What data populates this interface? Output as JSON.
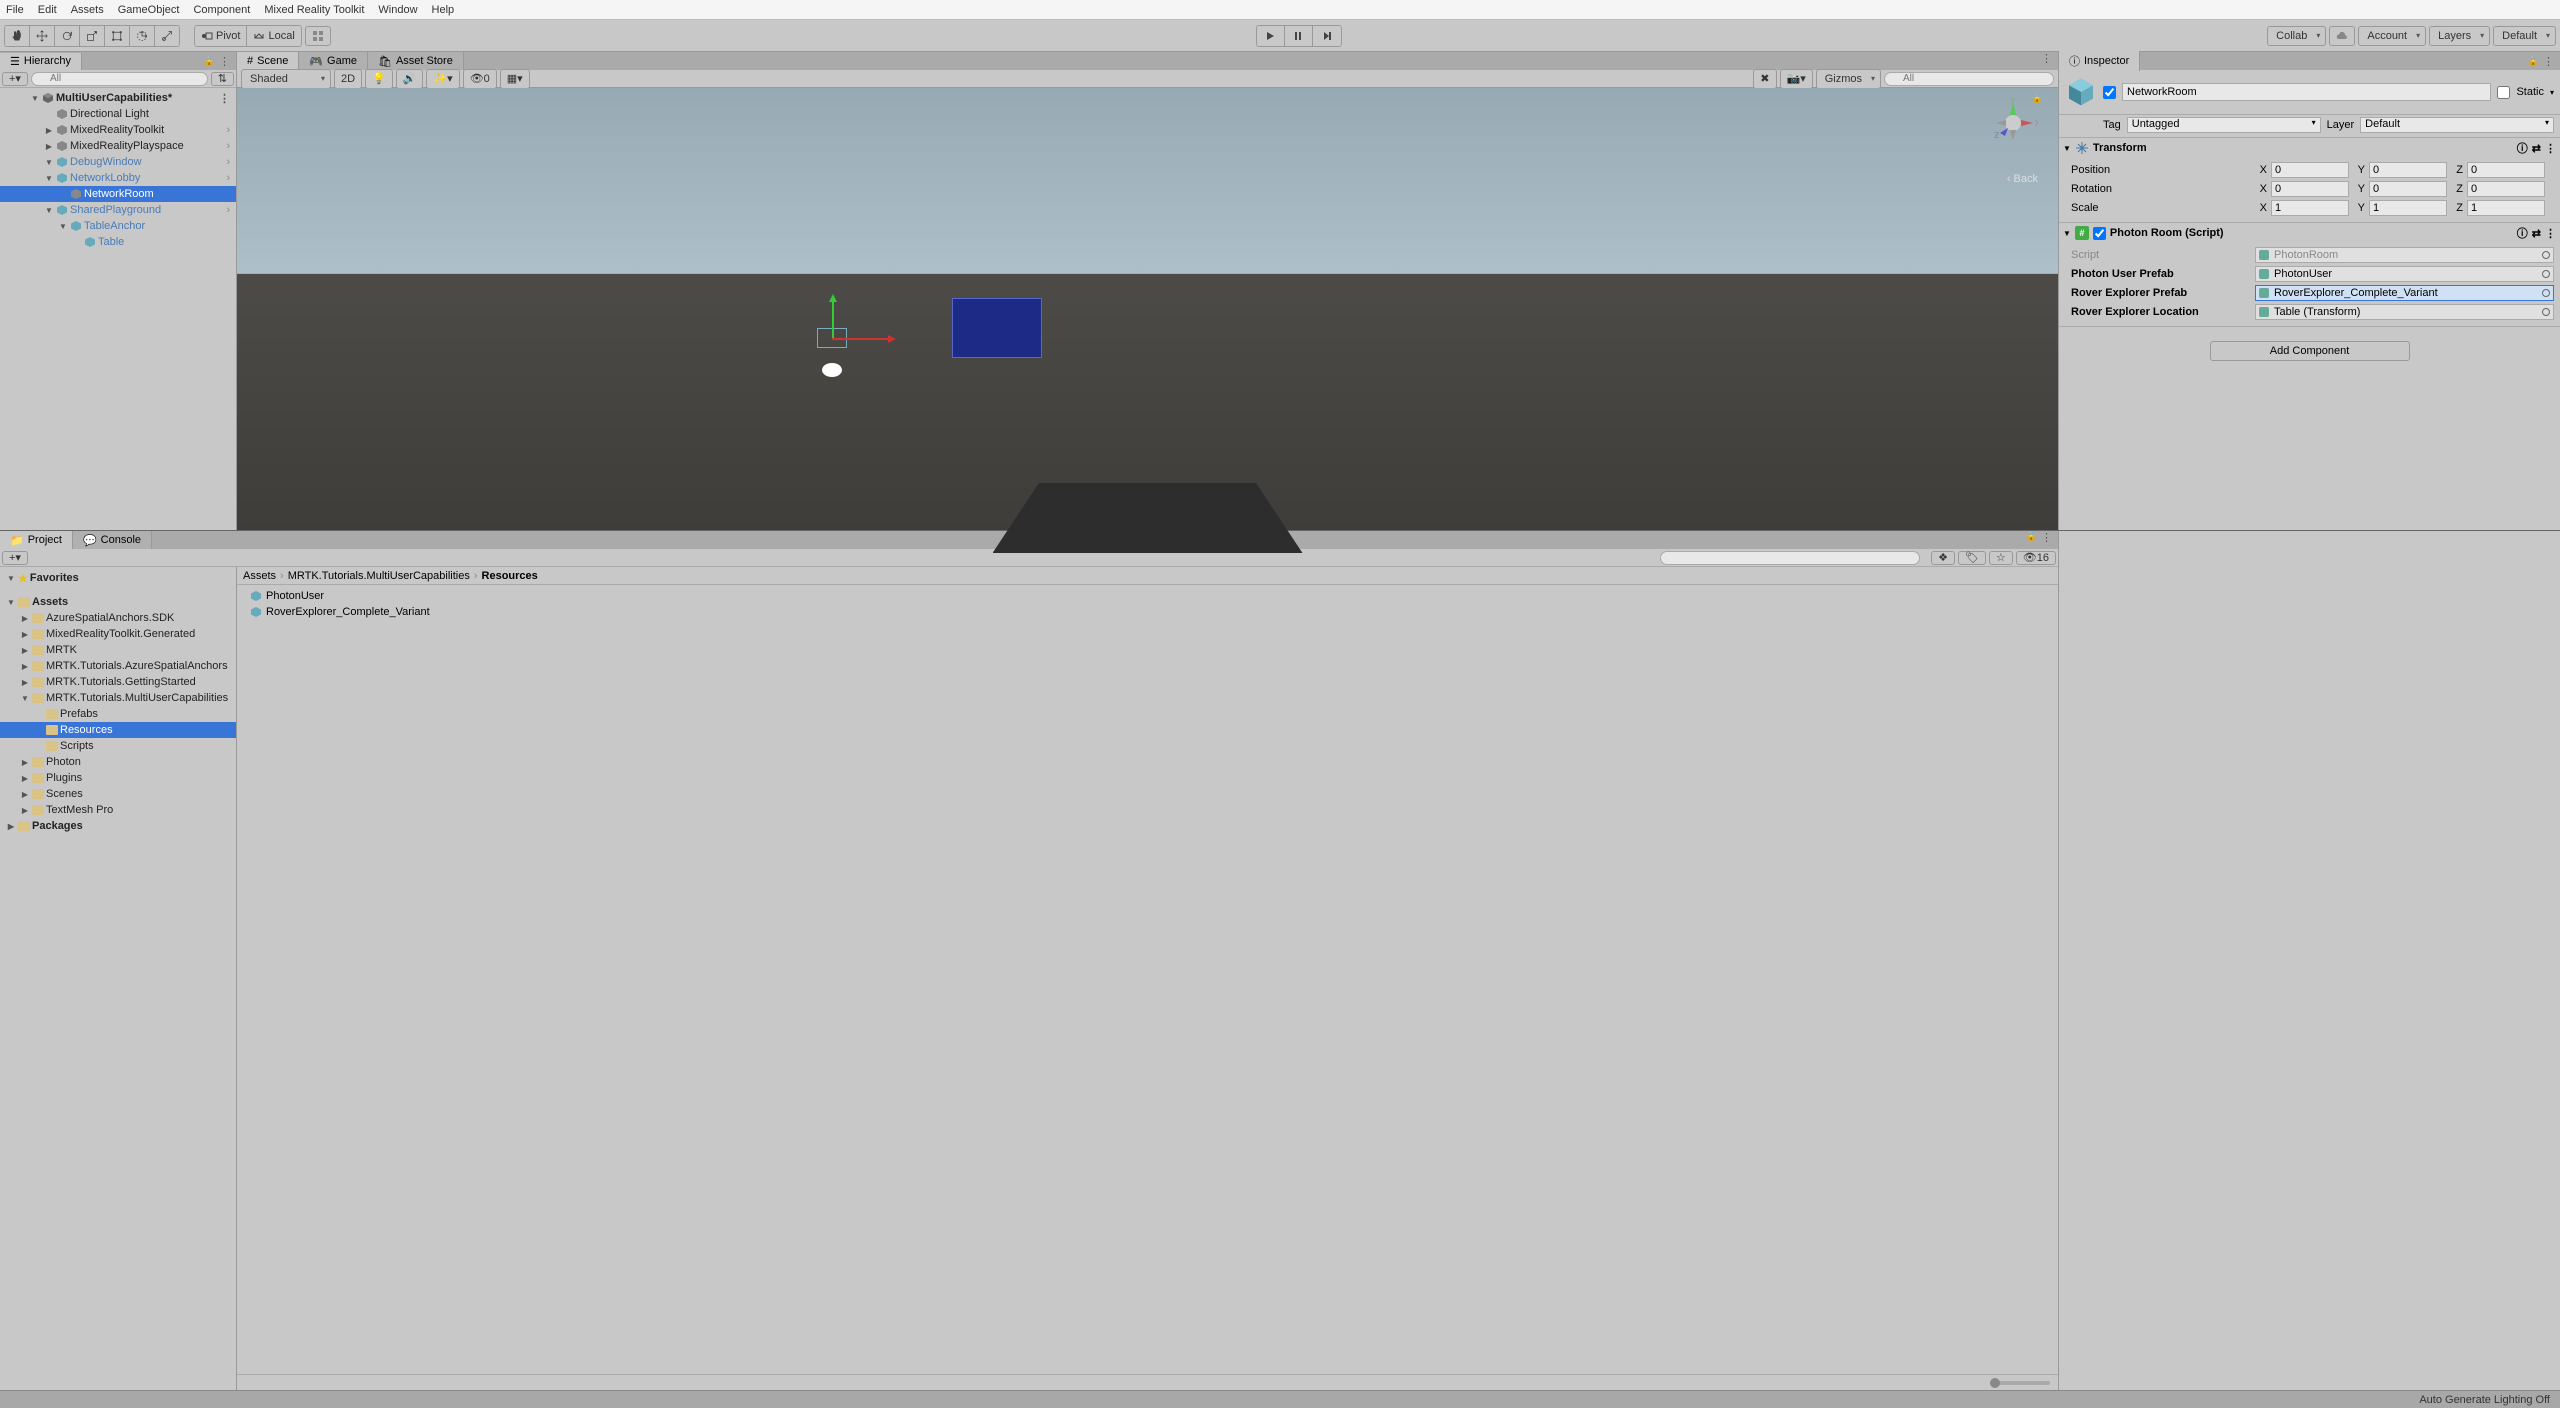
{
  "menubar": [
    "File",
    "Edit",
    "Assets",
    "GameObject",
    "Component",
    "Mixed Reality Toolkit",
    "Window",
    "Help"
  ],
  "toolbar": {
    "pivot": "Pivot",
    "local": "Local",
    "collab": "Collab",
    "account": "Account",
    "layers": "Layers",
    "layout": "Default"
  },
  "hierarchy": {
    "tab": "Hierarchy",
    "search_placeholder": "All",
    "scene": "MultiUserCapabilities*",
    "items": [
      {
        "t": "Directional Light",
        "d": 1
      },
      {
        "t": "MixedRealityToolkit",
        "d": 1,
        "arrow": 1
      },
      {
        "t": "MixedRealityPlayspace",
        "d": 1,
        "arrow": 1
      },
      {
        "t": "DebugWindow",
        "d": 1,
        "exp": 1,
        "pre": 1
      },
      {
        "t": "NetworkLobby",
        "d": 1,
        "exp": 1,
        "pre": 1
      },
      {
        "t": "NetworkRoom",
        "d": 2,
        "sel": 1
      },
      {
        "t": "SharedPlayground",
        "d": 1,
        "exp": 1,
        "pre": 1
      },
      {
        "t": "TableAnchor",
        "d": 2,
        "exp": 1,
        "pre": 1
      },
      {
        "t": "Table",
        "d": 3,
        "pre": 1
      }
    ]
  },
  "sceneview": {
    "tabs": [
      "Scene",
      "Game",
      "Asset Store"
    ],
    "shaded": "Shaded",
    "twoD": "2D",
    "gizmos": "Gizmos",
    "all": "All",
    "zero": "0",
    "back": "‹ Back",
    "axes": {
      "x": "x",
      "y": "y",
      "z": "z"
    }
  },
  "inspector": {
    "tab": "Inspector",
    "name": "NetworkRoom",
    "static": "Static",
    "tag_lbl": "Tag",
    "tag_val": "Untagged",
    "layer_lbl": "Layer",
    "layer_val": "Default",
    "transform": {
      "title": "Transform",
      "position": "Position",
      "rotation": "Rotation",
      "scale": "Scale",
      "px": "0",
      "py": "0",
      "pz": "0",
      "rx": "0",
      "ry": "0",
      "rz": "0",
      "sx": "1",
      "sy": "1",
      "sz": "1",
      "x": "X",
      "y": "Y",
      "z": "Z"
    },
    "photon": {
      "title": "Photon Room (Script)",
      "script_lbl": "Script",
      "script_val": "PhotonRoom",
      "user_lbl": "Photon User Prefab",
      "user_val": "PhotonUser",
      "rover_lbl": "Rover Explorer Prefab",
      "rover_val": "RoverExplorer_Complete_Variant",
      "loc_lbl": "Rover Explorer Location",
      "loc_val": "Table (Transform)"
    },
    "add_comp": "Add Component"
  },
  "project": {
    "tab": "Project",
    "console": "Console",
    "count": "16",
    "fav": "Favorites",
    "assets": "Assets",
    "packages": "Packages",
    "tree": [
      {
        "t": "AzureSpatialAnchors.SDK",
        "d": 1,
        "arrow": 1
      },
      {
        "t": "MixedRealityToolkit.Generated",
        "d": 1,
        "arrow": 1
      },
      {
        "t": "MRTK",
        "d": 1,
        "arrow": 1
      },
      {
        "t": "MRTK.Tutorials.AzureSpatialAnchors",
        "d": 1,
        "arrow": 1
      },
      {
        "t": "MRTK.Tutorials.GettingStarted",
        "d": 1,
        "arrow": 1
      },
      {
        "t": "MRTK.Tutorials.MultiUserCapabilities",
        "d": 1,
        "exp": 1
      },
      {
        "t": "Prefabs",
        "d": 2
      },
      {
        "t": "Resources",
        "d": 2,
        "sel": 1
      },
      {
        "t": "Scripts",
        "d": 2
      },
      {
        "t": "Photon",
        "d": 1,
        "arrow": 1
      },
      {
        "t": "Plugins",
        "d": 1,
        "arrow": 1
      },
      {
        "t": "Scenes",
        "d": 1,
        "arrow": 1
      },
      {
        "t": "TextMesh Pro",
        "d": 1,
        "arrow": 1
      }
    ],
    "breadcrumb": [
      "Assets",
      "MRTK.Tutorials.MultiUserCapabilities",
      "Resources"
    ],
    "list": [
      "PhotonUser",
      "RoverExplorer_Complete_Variant"
    ]
  },
  "statusbar": "Auto Generate Lighting Off"
}
